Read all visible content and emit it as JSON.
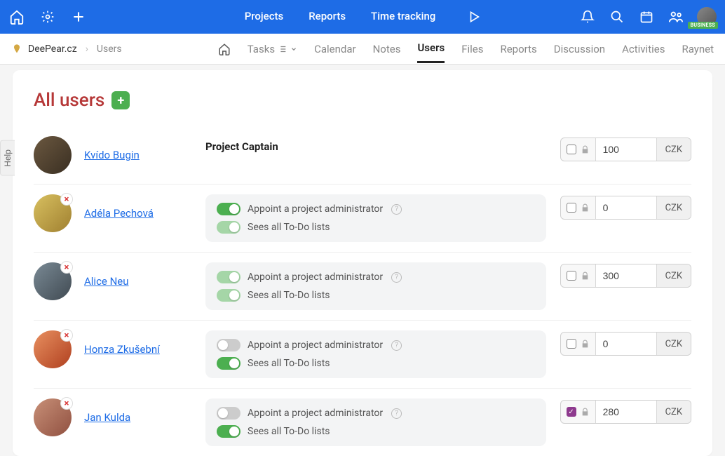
{
  "topnav": {
    "items": [
      "Projects",
      "Reports",
      "Time tracking"
    ]
  },
  "badge": "BUSINESS",
  "breadcrumb": {
    "project": "DeePear.cz",
    "current": "Users"
  },
  "subnav": {
    "items": [
      "Tasks",
      "Calendar",
      "Notes",
      "Users",
      "Files",
      "Reports",
      "Discussion",
      "Activities",
      "Raynet"
    ],
    "active": "Users"
  },
  "page": {
    "title": "All users"
  },
  "labels": {
    "appoint": "Appoint a project administrator",
    "sees_all": "Sees all To-Do lists",
    "currency": "CZK",
    "help_tab": "Help"
  },
  "users": [
    {
      "name": "Kvído Bugin",
      "role": "Project Captain",
      "removable": false,
      "rate": "100",
      "checked": false,
      "avatar": "a1"
    },
    {
      "name": "Adéla Pechová",
      "removable": true,
      "rate": "0",
      "checked": false,
      "avatar": "a2",
      "perms": {
        "appoint": "on",
        "sees_all": "on-light"
      }
    },
    {
      "name": "Alice Neu",
      "removable": true,
      "rate": "300",
      "checked": false,
      "avatar": "a3",
      "perms": {
        "appoint": "on-light",
        "sees_all": "on-light"
      }
    },
    {
      "name": "Honza Zkušební",
      "removable": true,
      "rate": "0",
      "checked": false,
      "avatar": "a4",
      "perms": {
        "appoint": "off",
        "sees_all": "on"
      }
    },
    {
      "name": "Jan Kulda",
      "removable": true,
      "rate": "280",
      "checked": true,
      "avatar": "a5",
      "perms": {
        "appoint": "off",
        "sees_all": "on"
      }
    }
  ]
}
